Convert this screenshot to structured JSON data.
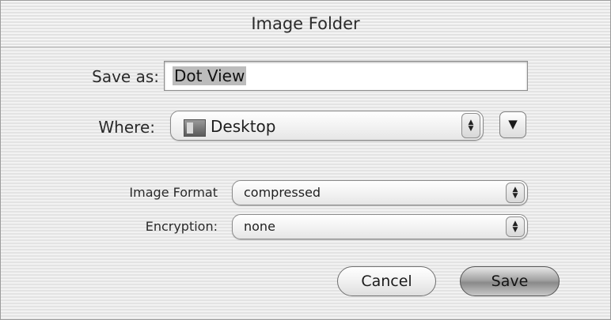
{
  "dialog": {
    "title": "Image Folder"
  },
  "save_as": {
    "label": "Save as:",
    "value": "Dot View"
  },
  "where": {
    "label": "Where:",
    "value": "Desktop",
    "icon": "folder-icon"
  },
  "image_format": {
    "label": "Image Format",
    "value": "compressed"
  },
  "encryption": {
    "label": "Encryption:",
    "value": "none"
  },
  "buttons": {
    "cancel": "Cancel",
    "save": "Save"
  }
}
